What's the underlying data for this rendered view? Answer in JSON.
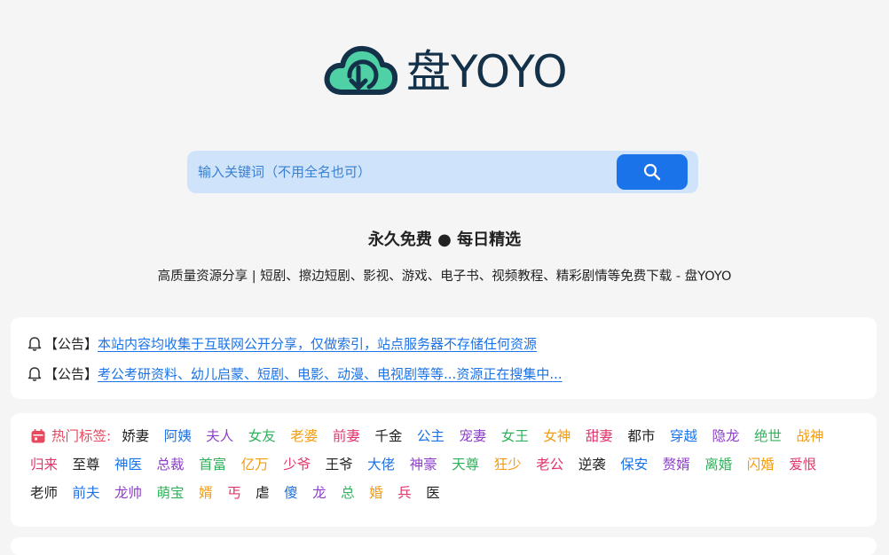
{
  "brand": {
    "logo_text": "盘YOYO"
  },
  "search": {
    "placeholder": "输入关键词（不用全名也可）"
  },
  "slogan": "永久免费 ● 每日精选",
  "description": "高质量资源分享 | 短剧、擦边短剧、影视、游戏、电子书、视频教程、精彩剧情等免费下载 - 盘YOYO",
  "notices": [
    {
      "label": "【公告】",
      "text": "本站内容均收集于互联网公开分享，仅做索引，站点服务器不存储任何资源"
    },
    {
      "label": "【公告】",
      "text": "考公考研资料、幼儿启蒙、短剧、电影、动漫、电视剧等等...资源正在搜集中..."
    }
  ],
  "hot_tags": {
    "heading": "热门标签:",
    "items": [
      {
        "text": "娇妻",
        "color": "#222222"
      },
      {
        "text": "阿姨",
        "color": "#1a73e8"
      },
      {
        "text": "夫人",
        "color": "#8e3fc9"
      },
      {
        "text": "女友",
        "color": "#2fb35b"
      },
      {
        "text": "老婆",
        "color": "#f39c12"
      },
      {
        "text": "前妻",
        "color": "#e3346a"
      },
      {
        "text": "千金",
        "color": "#222222"
      },
      {
        "text": "公主",
        "color": "#1a73e8"
      },
      {
        "text": "宠妻",
        "color": "#8e3fc9"
      },
      {
        "text": "女王",
        "color": "#2fb35b"
      },
      {
        "text": "女神",
        "color": "#f39c12"
      },
      {
        "text": "甜妻",
        "color": "#e3346a"
      },
      {
        "text": "都市",
        "color": "#222222"
      },
      {
        "text": "穿越",
        "color": "#1a73e8"
      },
      {
        "text": "隐龙",
        "color": "#8e3fc9"
      },
      {
        "text": "绝世",
        "color": "#2fb35b"
      },
      {
        "text": "战神",
        "color": "#f39c12"
      },
      {
        "text": "归来",
        "color": "#e3346a"
      },
      {
        "text": "至尊",
        "color": "#222222"
      },
      {
        "text": "神医",
        "color": "#1a73e8"
      },
      {
        "text": "总裁",
        "color": "#8e3fc9"
      },
      {
        "text": "首富",
        "color": "#2fb35b"
      },
      {
        "text": "亿万",
        "color": "#f39c12"
      },
      {
        "text": "少爷",
        "color": "#e3346a"
      },
      {
        "text": "王爷",
        "color": "#222222"
      },
      {
        "text": "大佬",
        "color": "#1a73e8"
      },
      {
        "text": "神豪",
        "color": "#8e3fc9"
      },
      {
        "text": "天尊",
        "color": "#2fb35b"
      },
      {
        "text": "狂少",
        "color": "#f39c12"
      },
      {
        "text": "老公",
        "color": "#e3346a"
      },
      {
        "text": "逆袭",
        "color": "#222222"
      },
      {
        "text": "保安",
        "color": "#1a73e8"
      },
      {
        "text": "赘婿",
        "color": "#8e3fc9"
      },
      {
        "text": "离婚",
        "color": "#2fb35b"
      },
      {
        "text": "闪婚",
        "color": "#f39c12"
      },
      {
        "text": "爱恨",
        "color": "#e3346a"
      },
      {
        "text": "老师",
        "color": "#222222"
      },
      {
        "text": "前夫",
        "color": "#1a73e8"
      },
      {
        "text": "龙帅",
        "color": "#8e3fc9"
      },
      {
        "text": "萌宝",
        "color": "#2fb35b"
      },
      {
        "text": "婿",
        "color": "#f39c12"
      },
      {
        "text": "丐",
        "color": "#e3346a"
      },
      {
        "text": "虐",
        "color": "#222222"
      },
      {
        "text": "傻",
        "color": "#1a73e8"
      },
      {
        "text": "龙",
        "color": "#8e3fc9"
      },
      {
        "text": "总",
        "color": "#2fb35b"
      },
      {
        "text": "婚",
        "color": "#f39c12"
      },
      {
        "text": "兵",
        "color": "#e3346a"
      },
      {
        "text": "医",
        "color": "#222222"
      }
    ]
  },
  "icons": [
    "cloud-download-icon",
    "search-icon",
    "bell-icon",
    "calendar-icon"
  ],
  "colors": {
    "accent": "#1a73e8",
    "search_bg": "#cfe4fb",
    "logo_green": "#4fd1a5",
    "logo_dark": "#14314a",
    "hot_red": "#e64a5f"
  }
}
